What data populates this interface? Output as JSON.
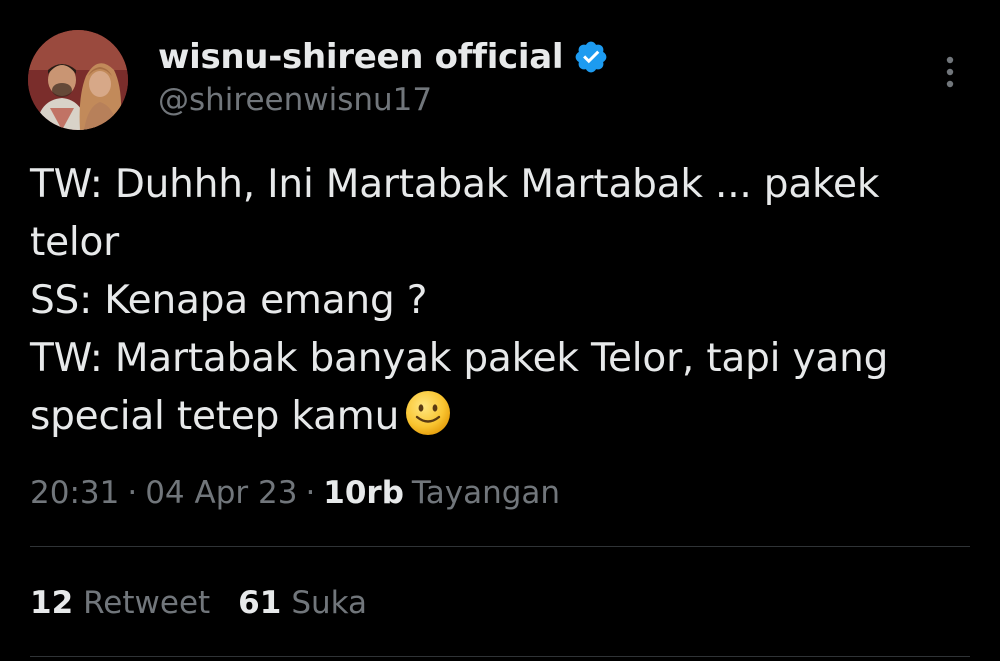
{
  "author": {
    "display_name": "wisnu-shireen official",
    "handle": "@shireenwisnu17",
    "verified_color": "#1d9bf0"
  },
  "tweet": {
    "lines": [
      "TW: Duhhh, Ini Martabak Martabak ... pakek",
      "telor",
      "SS: Kenapa emang ?",
      "TW: Martabak banyak pakek Telor, tapi yang",
      "special tetep kamu"
    ],
    "emoji": "slightly-smiling-face-icon"
  },
  "meta": {
    "time": "20:31",
    "separator": "·",
    "date": "04 Apr 23",
    "views_count": "10rb",
    "views_label": "Tayangan"
  },
  "stats": {
    "retweets_count": "12",
    "retweets_label": "Retweet",
    "likes_count": "61",
    "likes_label": "Suka"
  },
  "colors": {
    "background": "#000000",
    "text_primary": "#e7e9ea",
    "text_secondary": "#71767b",
    "divider": "#2f3336",
    "accent": "#1d9bf0"
  }
}
